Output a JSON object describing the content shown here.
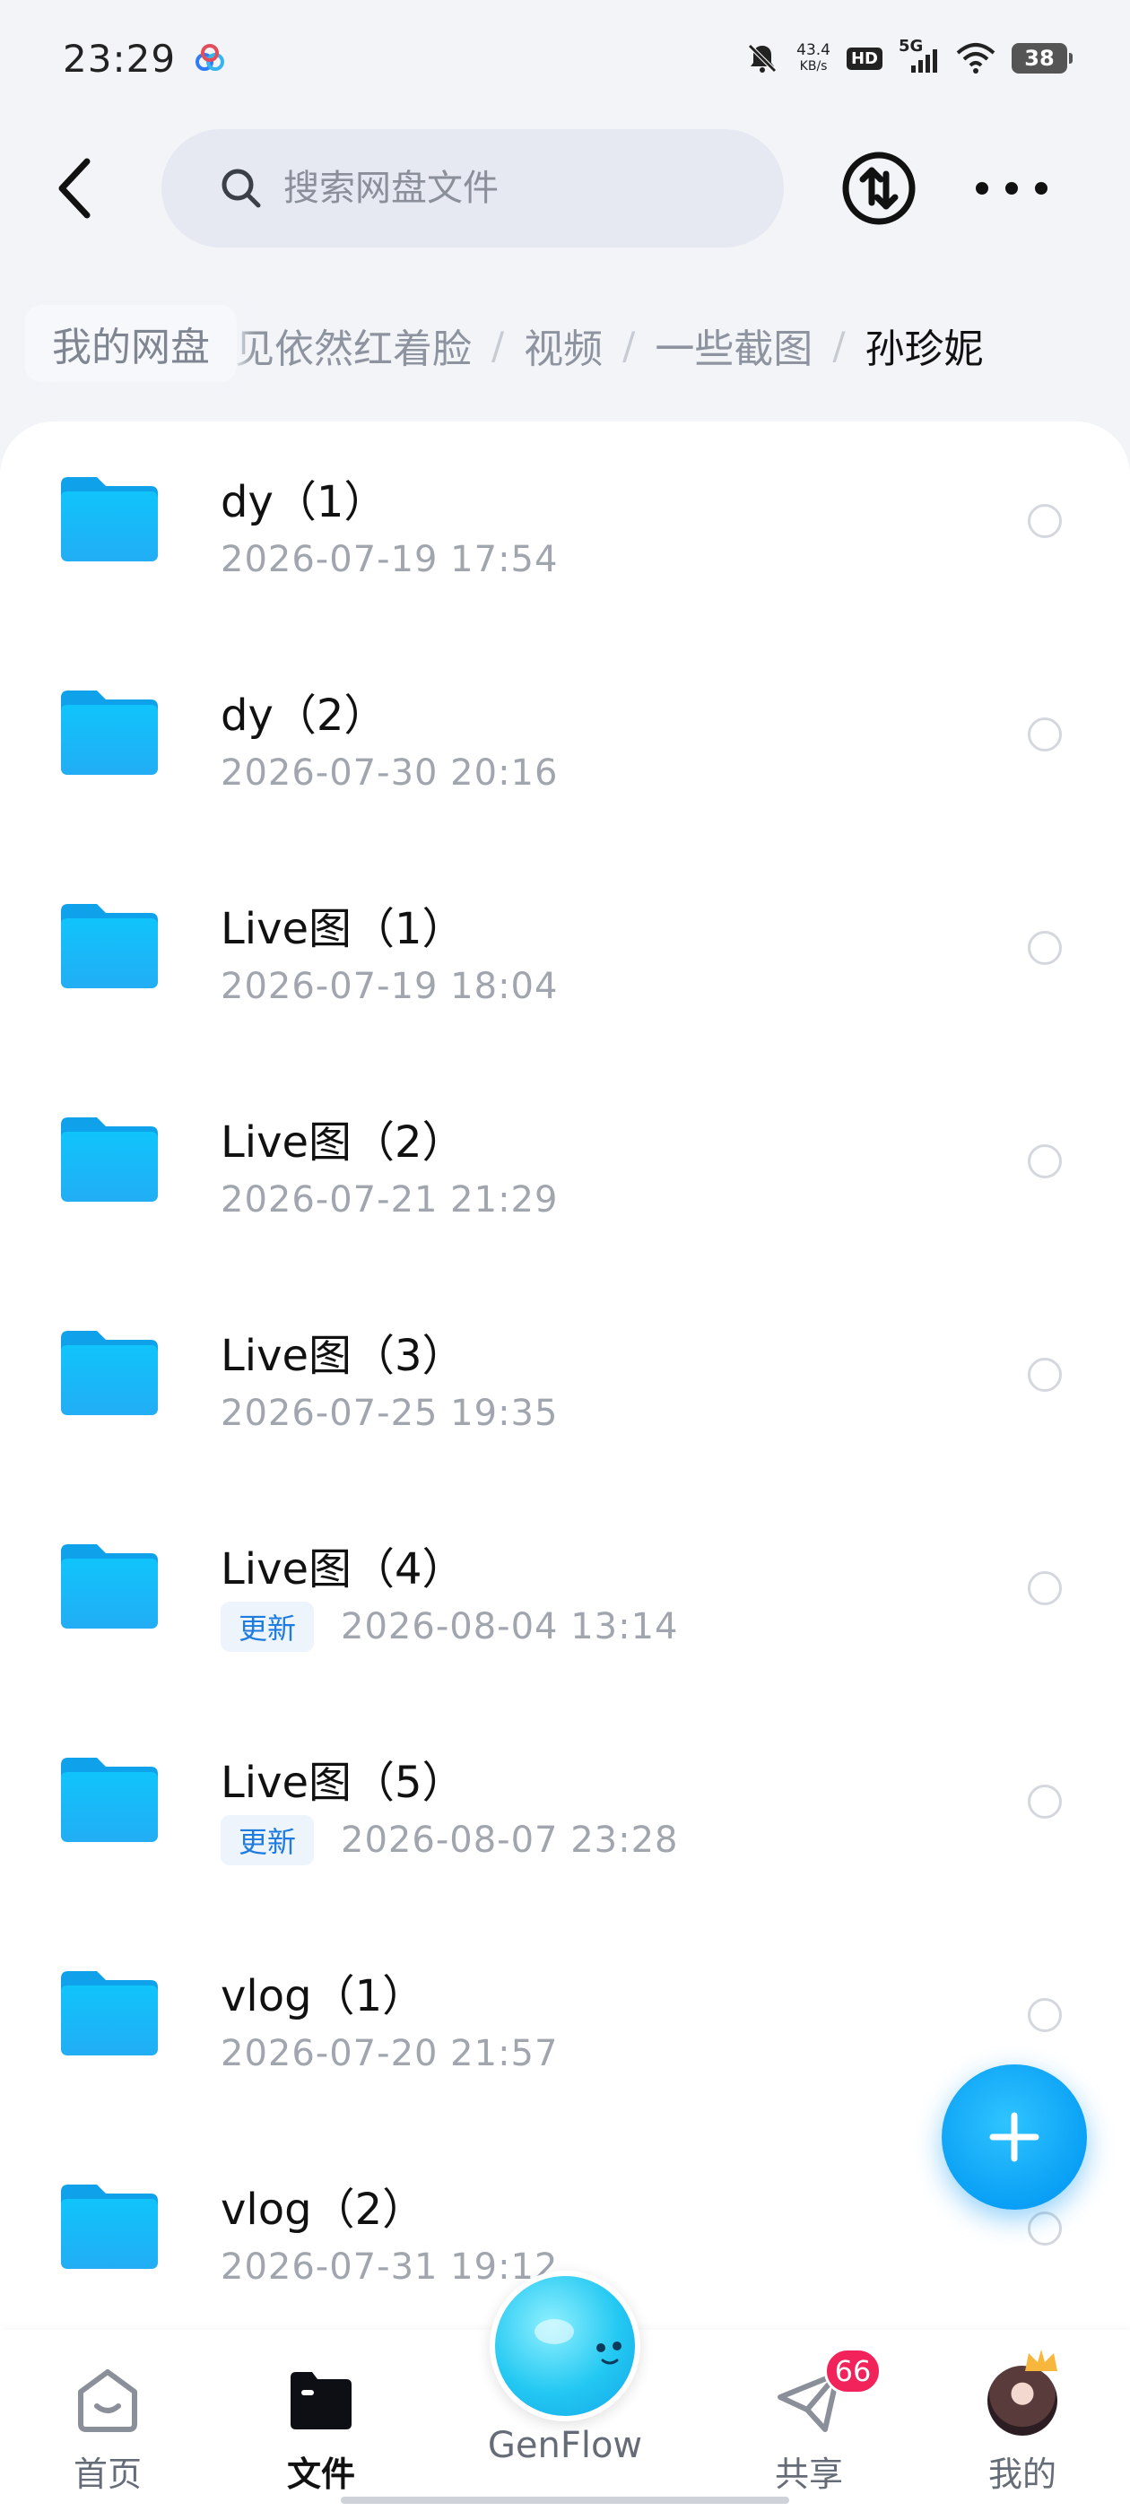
{
  "status_bar": {
    "time": "23:29",
    "net_speed_value": "43.4",
    "net_speed_unit": "KB/s",
    "hd": "HD",
    "network": "5G",
    "battery": "38",
    "icons": [
      "baidu-cloud-icon",
      "bell-mute-icon",
      "hd-icon",
      "signal-icon",
      "wifi-icon",
      "battery-icon"
    ]
  },
  "header": {
    "search_placeholder": "搜索网盘文件",
    "icons": [
      "back-arrow-icon",
      "search-icon",
      "transfer-icon",
      "more-icon"
    ]
  },
  "breadcrumb": {
    "home": "我的网盘",
    "items": [
      "见依然红着脸",
      "视频",
      "一些截图",
      "孙珍妮"
    ],
    "separator": "/"
  },
  "files": [
    {
      "name": "dy（1）",
      "date": "2026-07-19  17:54",
      "badge": ""
    },
    {
      "name": "dy（2）",
      "date": "2026-07-30  20:16",
      "badge": ""
    },
    {
      "name": "Live图（1）",
      "date": "2026-07-19  18:04",
      "badge": ""
    },
    {
      "name": "Live图（2）",
      "date": "2026-07-21  21:29",
      "badge": ""
    },
    {
      "name": "Live图（3）",
      "date": "2026-07-25  19:35",
      "badge": ""
    },
    {
      "name": "Live图（4）",
      "date": "2026-08-04  13:14",
      "badge": "更新"
    },
    {
      "name": "Live图（5）",
      "date": "2026-08-07  23:28",
      "badge": "更新"
    },
    {
      "name": "vlog（1）",
      "date": "2026-07-20  21:57",
      "badge": ""
    },
    {
      "name": "vlog（2）",
      "date": "2026-07-31  19:12",
      "badge": ""
    }
  ],
  "fab": {
    "icon": "plus-icon"
  },
  "bottom_nav": {
    "items": [
      {
        "label": "首页",
        "icon": "home-icon",
        "active": false
      },
      {
        "label": "文件",
        "icon": "folder-icon",
        "active": true
      },
      {
        "label": "GenFlow",
        "icon": "genflow-orb-icon",
        "active": false
      },
      {
        "label": "共享",
        "icon": "share-icon",
        "active": false,
        "badge": "66"
      },
      {
        "label": "我的",
        "icon": "avatar-icon",
        "active": false
      }
    ]
  },
  "colors": {
    "accent": "#0aa0f5",
    "folder": "#18b4f6",
    "badge_red": "#f2225a",
    "new_badge_text": "#1e7be0"
  }
}
